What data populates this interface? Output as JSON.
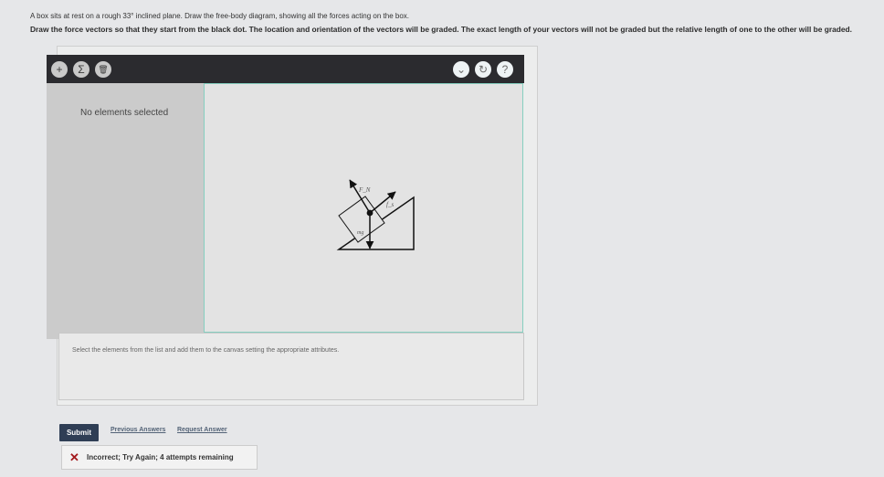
{
  "question": {
    "line1": "A box sits at rest on a rough 33° inclined plane. Draw the free-body diagram, showing all the forces acting on the box.",
    "line2": "Draw the force vectors so that they start from the black dot. The location and orientation of the vectors will be graded. The exact length of your vectors will not be graded but the relative length of one to the other will be graded."
  },
  "toolbar": {
    "add_icon": "plus-icon",
    "sigma_icon": "sigma-icon",
    "delete_icon": "trash-icon",
    "dropdown_icon": "chevron-down-icon",
    "reset_icon": "reset-icon",
    "help_icon": "help-icon",
    "add_glyph": "+",
    "sigma_glyph": "Σ",
    "delete_glyph": "🗑",
    "dropdown_glyph": "⌄",
    "reset_glyph": "↻",
    "help_glyph": "?"
  },
  "sidebar": {
    "status": "No elements selected"
  },
  "canvas": {
    "labels": {
      "normal": "F_N",
      "friction": "f_s",
      "weight": "mg"
    }
  },
  "instructions": "Select the elements from the list and add them to the canvas setting the appropriate attributes.",
  "actions": {
    "submit": "Submit",
    "previous_answers": "Previous Answers",
    "request_answer": "Request Answer"
  },
  "feedback": {
    "icon": "x-mark-icon",
    "text": "Incorrect; Try Again; 4 attempts remaining"
  },
  "colors": {
    "toolbar_bg": "#2b2b2f",
    "submit_bg": "#2f3e55",
    "incorrect": "#a3191d",
    "canvas_border": "#86cfc0"
  }
}
